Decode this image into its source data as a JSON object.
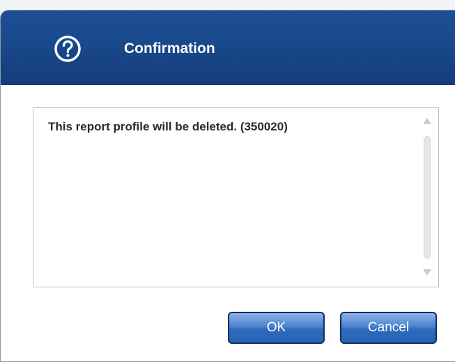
{
  "dialog": {
    "title": "Confirmation",
    "title_icon": "question-circle-icon",
    "message": "This report profile will be deleted. (350020)",
    "ok_label": "OK",
    "cancel_label": "Cancel"
  },
  "colors": {
    "titlebar": "#1a4a8e",
    "button": "#3a74c4",
    "button_border": "#0f2f63"
  }
}
